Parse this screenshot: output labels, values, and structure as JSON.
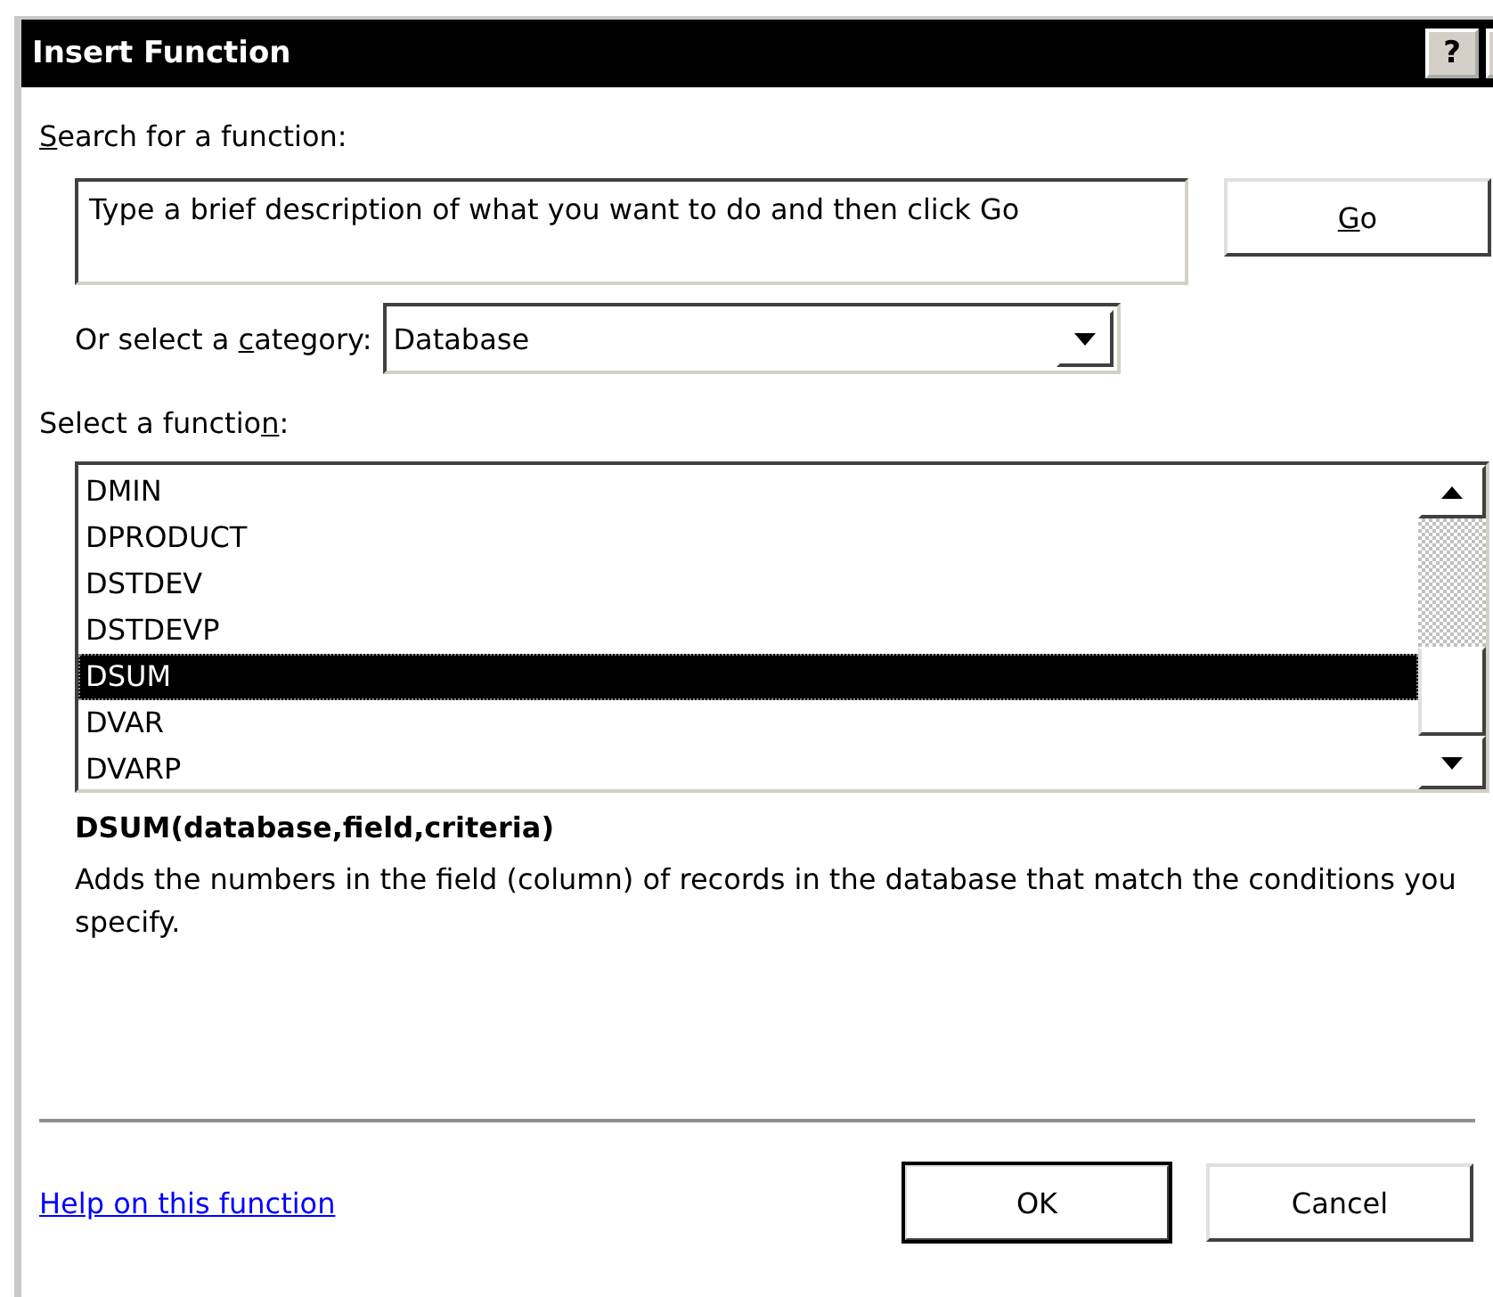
{
  "window": {
    "title": "Insert Function",
    "help_button": "?"
  },
  "search": {
    "label": {
      "mnemonic": "S",
      "after": "earch for a function:"
    },
    "value": "Type a brief description of what you want to do and then click Go",
    "go_button": {
      "mnemonic": "G",
      "after": "o"
    }
  },
  "category": {
    "label": {
      "before": "Or select a ",
      "mnemonic": "c",
      "after": "ategory:"
    },
    "value": "Database"
  },
  "functions": {
    "label": {
      "before": "Select a functio",
      "mnemonic": "n",
      "after": ":"
    },
    "items": [
      {
        "name": "DMIN",
        "selected": false
      },
      {
        "name": "DPRODUCT",
        "selected": false
      },
      {
        "name": "DSTDEV",
        "selected": false
      },
      {
        "name": "DSTDEVP",
        "selected": false
      },
      {
        "name": "DSUM",
        "selected": true
      },
      {
        "name": "DVAR",
        "selected": false
      },
      {
        "name": "DVARP",
        "selected": false
      }
    ]
  },
  "signature": "DSUM(database,field,criteria)",
  "description": "Adds the numbers in the field (column) of records in the database that match the conditions you specify.",
  "help_link": "Help on this function",
  "buttons": [
    {
      "label": "OK",
      "default": true
    },
    {
      "label": "Cancel",
      "default": false
    }
  ]
}
